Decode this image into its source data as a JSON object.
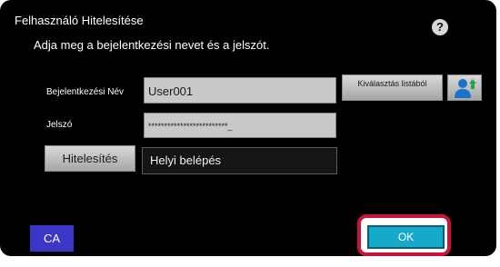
{
  "dialog": {
    "title": "Felhasználó Hitelesítése",
    "help_symbol": "?",
    "instruction": "Adja meg a bejelentkezési nevet és a jelszót."
  },
  "login": {
    "label": "Bejelentkezési Név",
    "value": "User001",
    "select_button": "Kiválasztás listából",
    "user_icon": "user-upload-icon"
  },
  "password": {
    "label": "Jelszó",
    "value": "*************************_"
  },
  "auth": {
    "button": "Hitelesítés",
    "destination": "Helyi belépés"
  },
  "footer": {
    "ca_button": "CA",
    "ok_button": "OK"
  },
  "colors": {
    "panel": "#000000",
    "ca_button": "#3b36c7",
    "ok_button": "#17a9c9",
    "highlight": "#c7143a"
  }
}
